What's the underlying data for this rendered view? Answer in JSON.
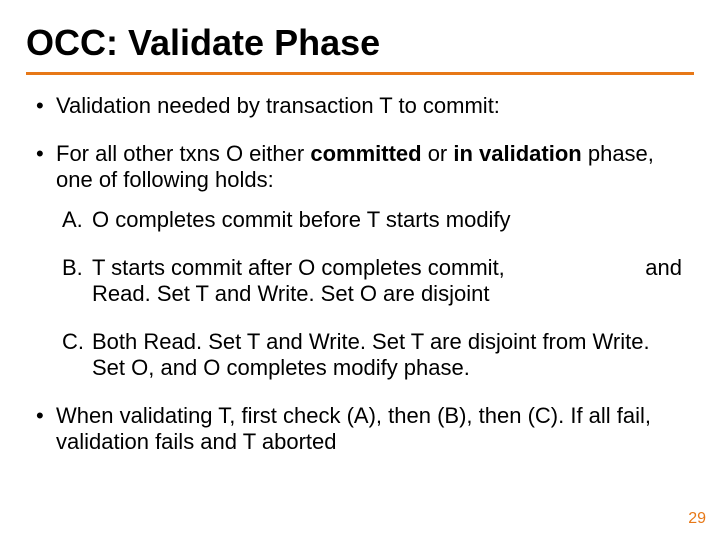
{
  "title": "OCC:  Validate Phase",
  "bullets": {
    "b1": "Validation needed by transaction T to commit:",
    "b2_pre": "For all other txns O either ",
    "b2_committed": "committed",
    "b2_or": " or ",
    "b2_validation": "in validation",
    "b2_post": " phase, one of following holds:",
    "A_letter": "A.",
    "A": "O completes commit before T starts modify",
    "B_letter": "B.",
    "B_line1": "T starts commit after O completes commit,",
    "B_and": "and",
    "B_line2": "Read. Set T and Write. Set O are disjoint",
    "C_letter": "C.",
    "C": "Both Read. Set T and Write. Set T are disjoint from Write. Set O, and O completes modify phase.",
    "b3": "When validating T, first check (A), then (B), then (C). If all fail, validation fails and T aborted"
  },
  "page_number": "29"
}
